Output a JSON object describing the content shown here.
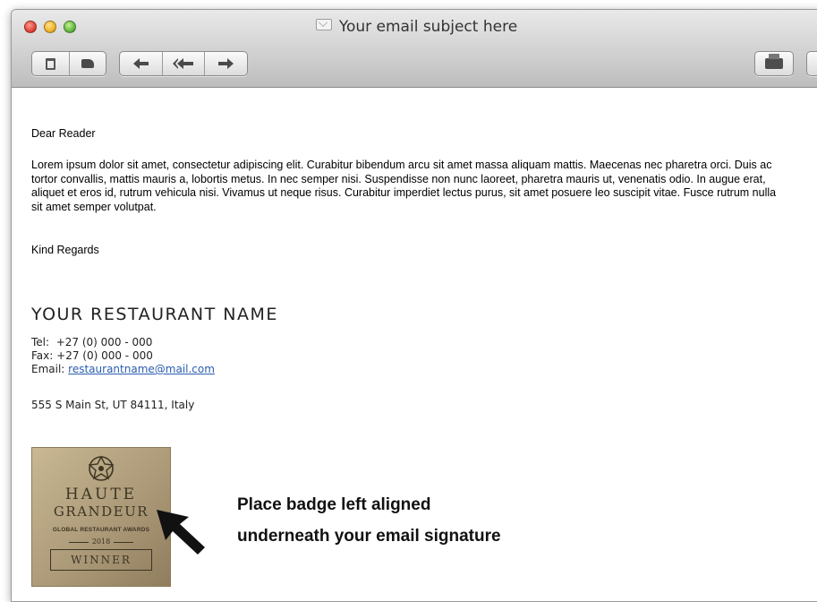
{
  "window": {
    "title": "Your email subject here"
  },
  "toolbar": {
    "buttons": [
      {
        "name": "delete",
        "icon": "trash-icon"
      },
      {
        "name": "junk",
        "icon": "thumbs-down-icon"
      },
      {
        "name": "reply",
        "icon": "reply-icon"
      },
      {
        "name": "reply-all",
        "icon": "reply-all-icon"
      },
      {
        "name": "forward",
        "icon": "forward-icon"
      },
      {
        "name": "print",
        "icon": "printer-icon"
      },
      {
        "name": "flag",
        "icon": "flag-icon"
      }
    ]
  },
  "email": {
    "greeting": "Dear Reader",
    "body": "Lorem ipsum dolor sit amet, consectetur adipiscing elit. Curabitur bibendum arcu sit amet massa aliquam mattis. Maecenas nec pharetra orci. Duis ac tortor convallis, mattis mauris a, lobortis metus. In nec semper nisi. Suspendisse non nunc laoreet, pharetra mauris ut, venenatis odio. In augue erat, aliquet et eros id, rutrum vehicula nisi. Vivamus ut neque risus. Curabitur imperdiet lectus purus, sit amet posuere leo suscipit vitae. Fusce rutrum nulla sit amet semper volutpat.",
    "closing": "Kind Regards"
  },
  "signature": {
    "name": "YOUR RESTAURANT NAME",
    "tel_label": "Tel:",
    "tel": "+27 (0) 000 - 000",
    "fax_label": "Fax:",
    "fax": "+27 (0) 000 - 000",
    "email_label": "Email:",
    "email": "restaurantname@mail.com",
    "address": "555 S Main St, UT 84111, Italy"
  },
  "badge": {
    "line1": "HAUTE",
    "line2": "GRANDEUR",
    "line3": "GLOBAL RESTAURANT AWARDS",
    "year": "2018",
    "award": "WINNER"
  },
  "callout": {
    "line1": "Place badge left aligned",
    "line2": "underneath your email signature"
  },
  "colors": {
    "link": "#2a5db0",
    "titlebar": "#cfcfcf",
    "badge_gold": "#b5a27f"
  }
}
